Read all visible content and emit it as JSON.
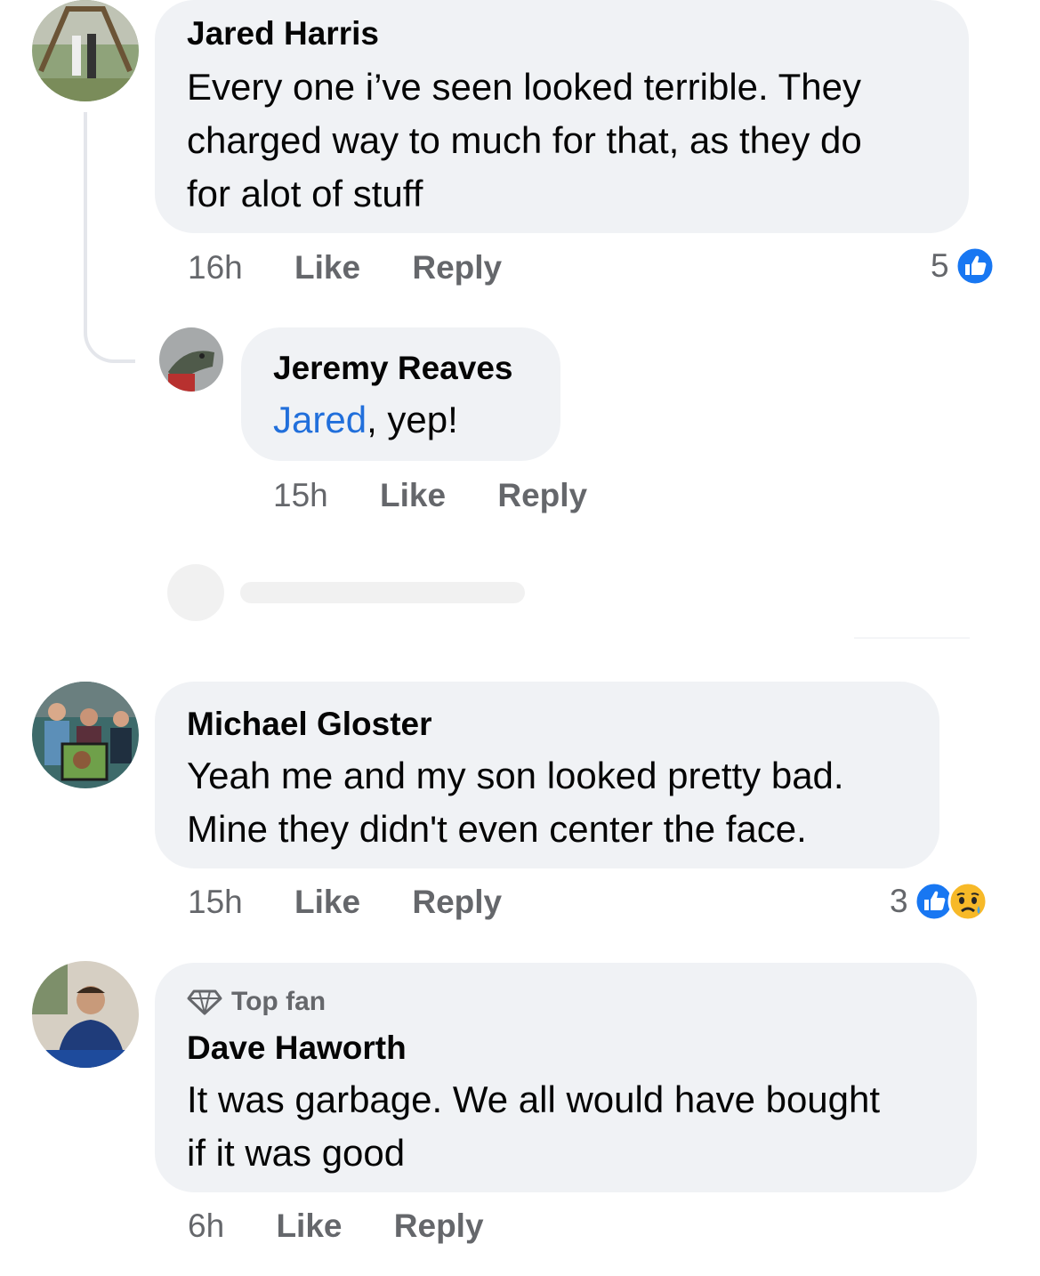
{
  "comments": [
    {
      "name": "Jared Harris",
      "lines": [
        "Every one i’ve seen looked terrible. They",
        "charged way to much for that, as they do",
        "for alot of stuff"
      ],
      "time": "16h",
      "like": "Like",
      "reply": "Reply",
      "reaction_count": "5"
    },
    {
      "name": "Jeremy Reaves",
      "mention": "Jared",
      "text_after_mention": ", yep!",
      "time": "15h",
      "like": "Like",
      "reply": "Reply"
    },
    {
      "name": "Michael Gloster",
      "lines": [
        "Yeah me and my son looked pretty bad.",
        "Mine they didn't even center the face."
      ],
      "time": "15h",
      "like": "Like",
      "reply": "Reply",
      "reaction_count": "3"
    },
    {
      "badge": "Top fan",
      "name": "Dave Haworth",
      "lines": [
        "It was garbage. We all would have bought",
        "if it was good"
      ],
      "time": "6h",
      "like": "Like",
      "reply": "Reply"
    }
  ],
  "colors": {
    "bubble": "#f0f2f5",
    "meta": "#65676b",
    "mention": "#216fdb",
    "like_blue": "#1877f2"
  },
  "icons": {
    "like_reaction": "like-reaction-icon",
    "sad_reaction": "sad-reaction-icon",
    "top_fan": "diamond-icon"
  }
}
